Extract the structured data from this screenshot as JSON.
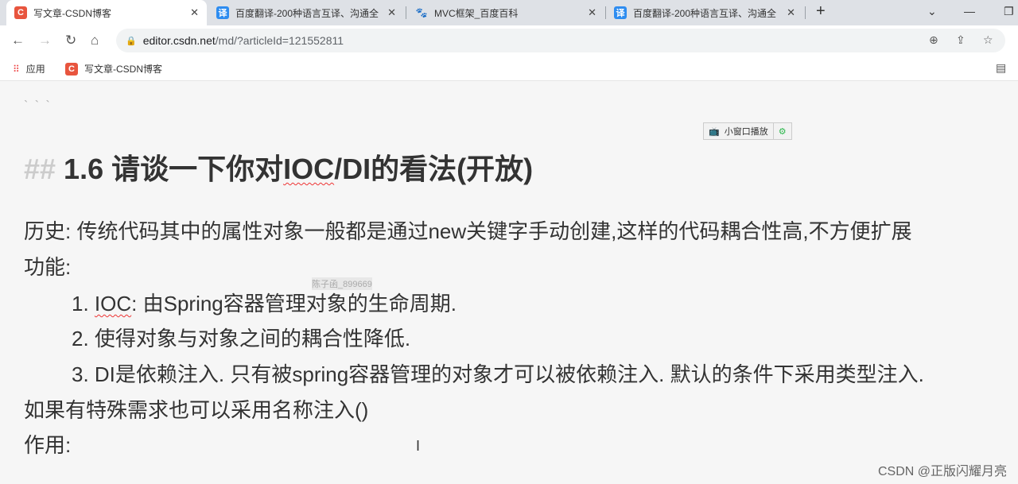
{
  "browser": {
    "tabs": [
      {
        "title": "写文章-CSDN博客",
        "favicon": "C",
        "color": "#e8553e",
        "active": true
      },
      {
        "title": "百度翻译-200种语言互译、沟通全",
        "favicon": "译",
        "color": "#2d8cf0",
        "active": false
      },
      {
        "title": "MVC框架_百度百科",
        "favicon": "🐾",
        "color": "#2932e1",
        "active": false
      },
      {
        "title": "百度翻译-200种语言互译、沟通全",
        "favicon": "译",
        "color": "#2d8cf0",
        "active": false
      }
    ],
    "new_tab": "+",
    "url_host": "editor.csdn.net",
    "url_path": "/md/?articleId=121552811",
    "bookmarks": {
      "apps": "应用",
      "item": "写文章-CSDN博客"
    }
  },
  "editor": {
    "code_fence": "` ` `",
    "mini_player": "小窗口播放",
    "heading_hash": "##",
    "heading_pre": "1.6 请谈一下你对",
    "heading_squig": "IOC",
    "heading_post": "/DI的看法(开放)",
    "p1": "历史: 传统代码其中的属性对象一般都是通过new关键字手动创建,这样的代码耦合性高,不方便扩展",
    "p2": "功能:",
    "li1_num": "1. ",
    "li1_squig": "IOC",
    "li1_rest": ": 由Spring容器管理对象的生命周期.",
    "li2": "2. 使得对象与对象之间的耦合性降低.",
    "li3": "3. DI是依赖注入. 只有被spring容器管理的对象才可以被依赖注入. 默认的条件下采用类型注入.",
    "p3": "如果有特殊需求也可以采用名称注入()",
    "p4": "作用:",
    "watermark": "陈子函_899669",
    "credit": "CSDN @正版闪耀月亮"
  }
}
